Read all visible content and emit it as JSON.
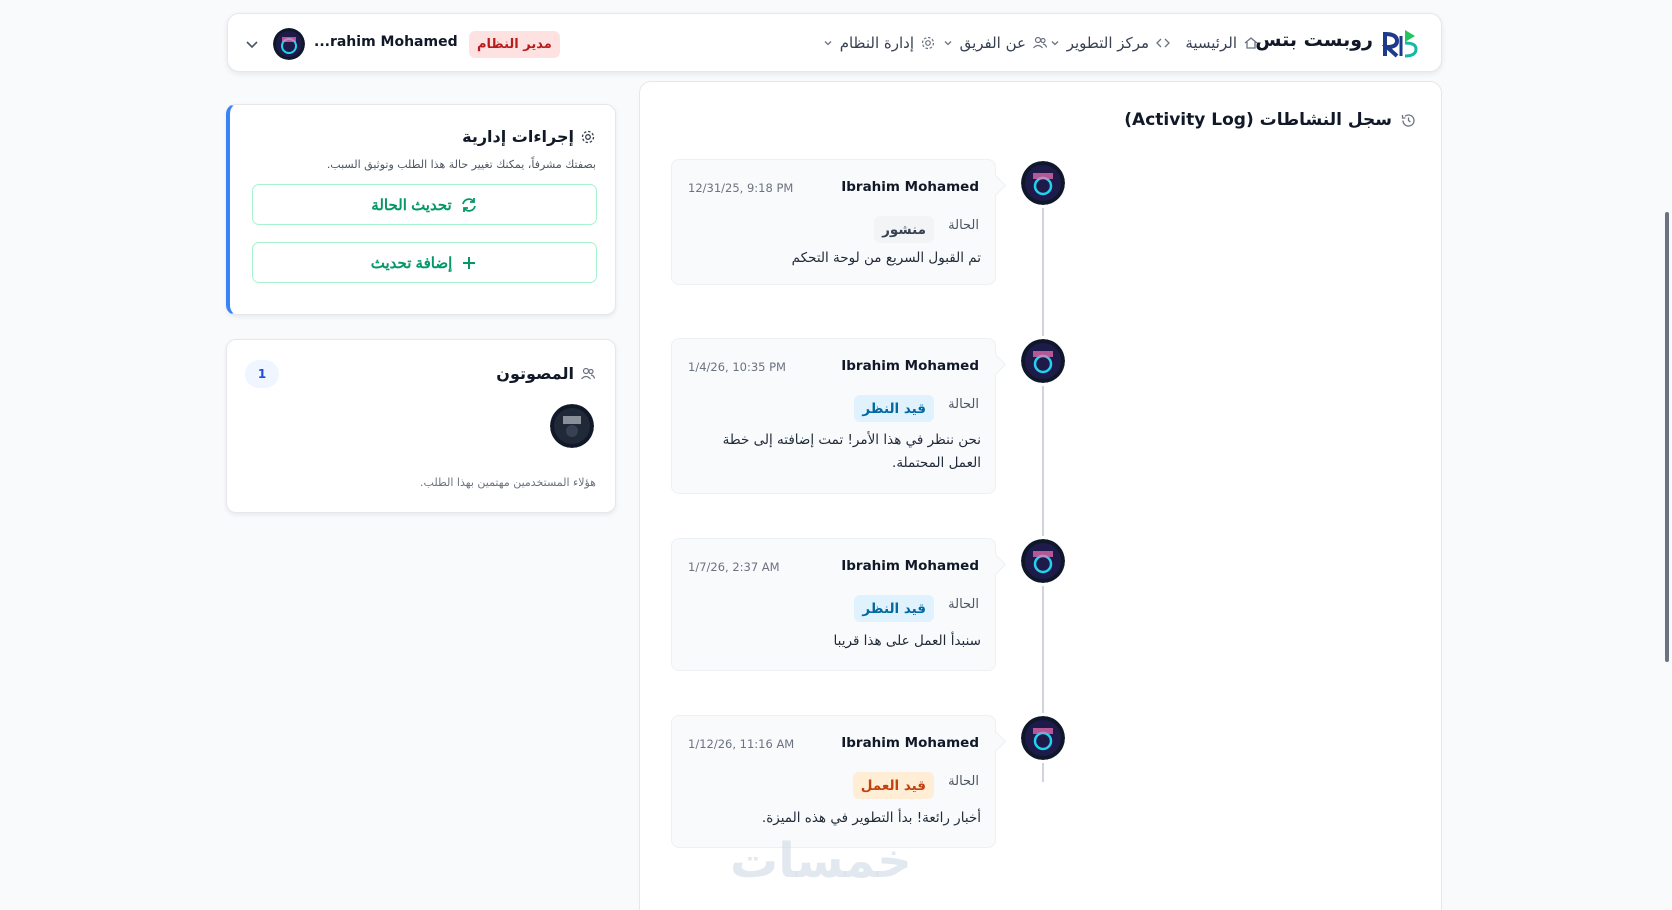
{
  "nav": {
    "brand": "روبست بتس",
    "items": [
      {
        "label": "الرئيسية",
        "icon": "home-icon"
      },
      {
        "label": "مركز التطوير",
        "icon": "code-icon"
      },
      {
        "label": "عن الفريق",
        "icon": "users-icon"
      },
      {
        "label": "إدارة النظام",
        "icon": "gear-icon"
      }
    ],
    "role_badge": "مدير النظام",
    "user_name": "...rahim Mohamed"
  },
  "admin_actions": {
    "title": "إجراءات إدارية",
    "description": "بصفتك مشرفاً، يمكنك تغيير حالة هذا الطلب وتوثيق السبب.",
    "update_status_label": "تحديث الحالة",
    "add_update_label": "إضافة تحديث"
  },
  "voters": {
    "title": "المصوتون",
    "count": "1",
    "note": "هؤلاء المستخدمين مهتمين بهذا الطلب."
  },
  "activity_log": {
    "title": "سجل النشاطات (Activity Log)",
    "status_label": "الحالة",
    "entries": [
      {
        "author": "Ibrahim Mohamed",
        "time": "12/31/25, 9:18 PM",
        "status": "منشور",
        "status_kind": "published",
        "text": "تم القبول السريع من لوحة التحكم"
      },
      {
        "author": "Ibrahim Mohamed",
        "time": "1/4/26, 10:35 PM",
        "status": "قيد النظر",
        "status_kind": "review",
        "text": "نحن ننظر في هذا الأمر! تمت إضافته إلى خطة العمل المحتملة."
      },
      {
        "author": "Ibrahim Mohamed",
        "time": "1/7/26, 2:37 AM",
        "status": "قيد النظر",
        "status_kind": "review",
        "text": "سنبدأ العمل على هذا قريبا"
      },
      {
        "author": "Ibrahim Mohamed",
        "time": "1/12/26, 11:16 AM",
        "status": "قيد العمل",
        "status_kind": "progress",
        "text": "أخبار رائعة! بدأ التطوير في هذه الميزة."
      }
    ]
  },
  "watermark": "خمسات",
  "colors": {
    "accent_green": "#059669",
    "accent_blue": "#3b82f6",
    "admin_red": "#b91c1c"
  }
}
